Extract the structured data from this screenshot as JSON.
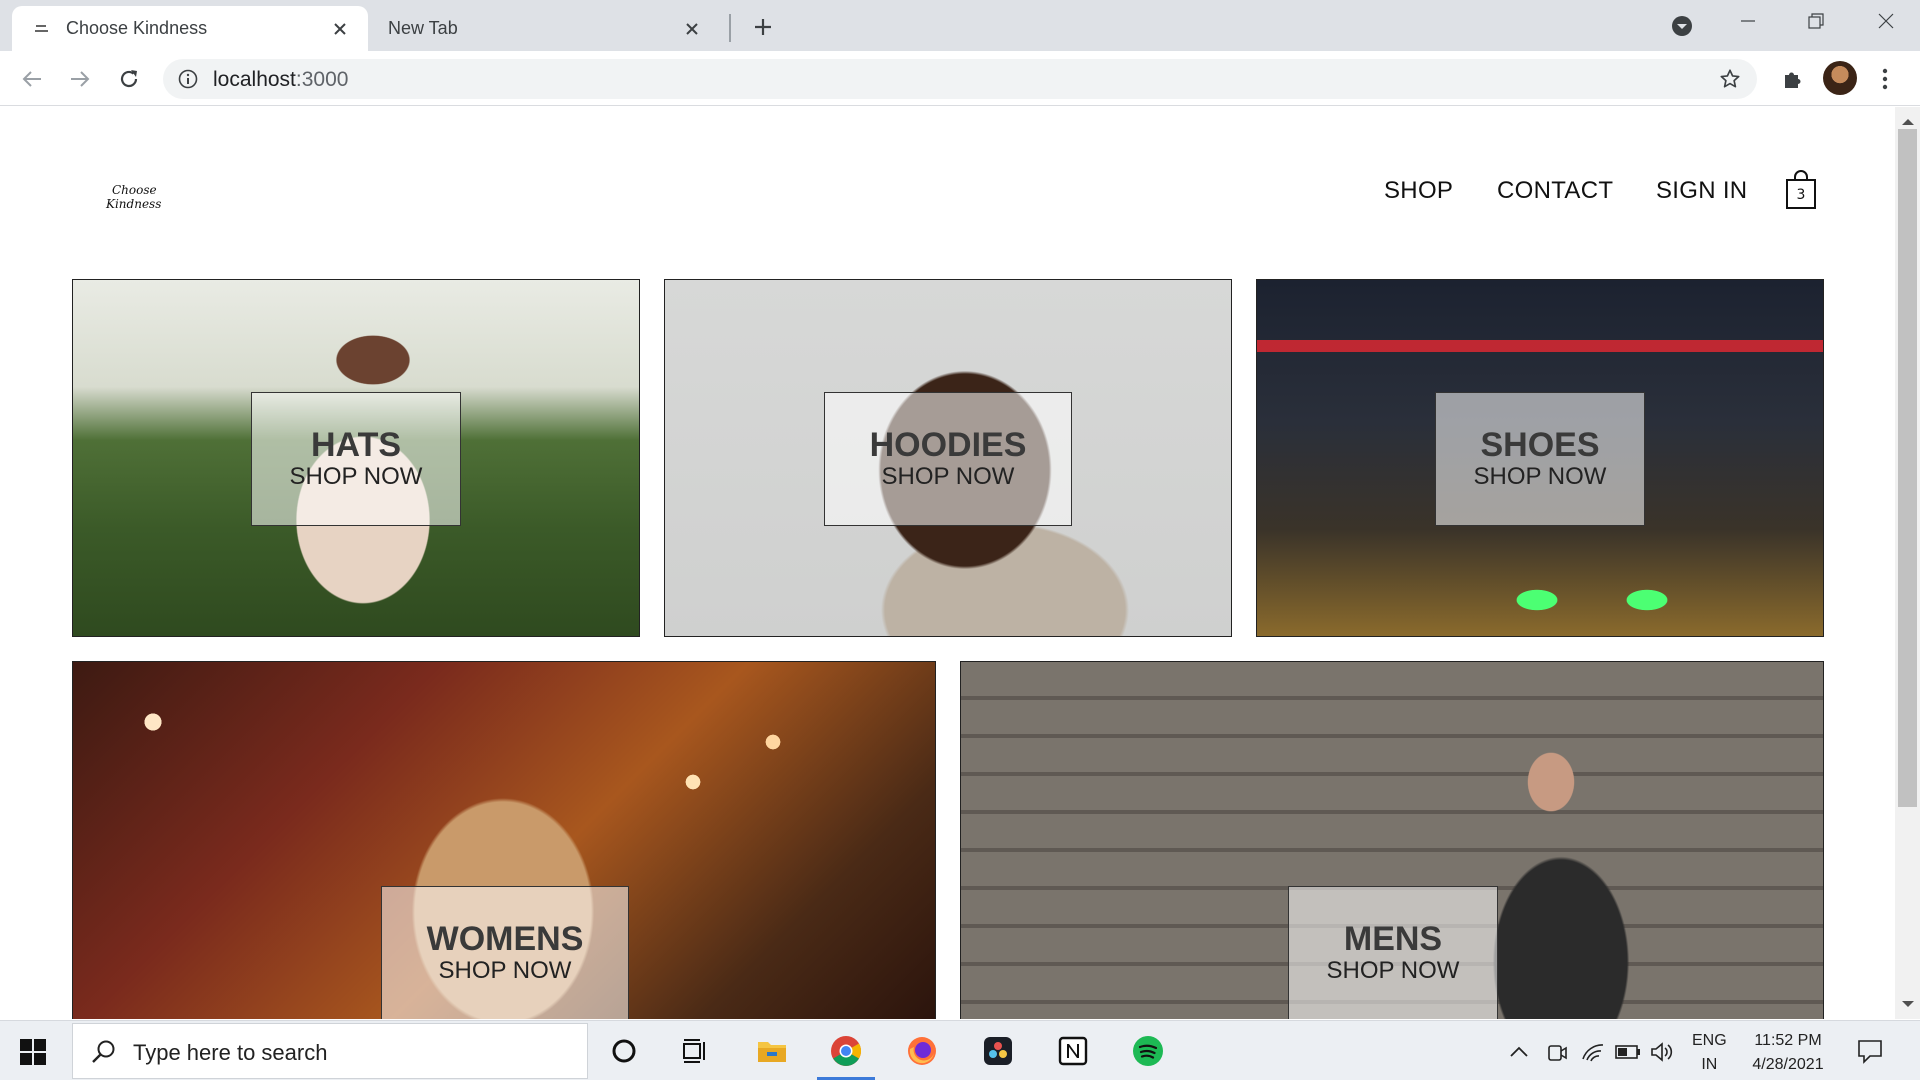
{
  "browser": {
    "tabs": [
      {
        "label": "Choose Kindness",
        "active": true
      },
      {
        "label": "New Tab",
        "active": false
      }
    ],
    "url_host": "localhost",
    "url_port": ":3000"
  },
  "site": {
    "logo_line1": "Choose",
    "logo_line2": "Kindness",
    "nav": {
      "shop": "SHOP",
      "contact": "CONTACT",
      "signin": "SIGN IN"
    },
    "cart_count": "3"
  },
  "categories": [
    {
      "title": "HATS",
      "cta": "SHOP NOW"
    },
    {
      "title": "HOODIES",
      "cta": "SHOP NOW"
    },
    {
      "title": "SHOES",
      "cta": "SHOP NOW"
    },
    {
      "title": "WOMENS",
      "cta": "SHOP NOW"
    },
    {
      "title": "MENS",
      "cta": "SHOP NOW"
    }
  ],
  "taskbar": {
    "search_placeholder": "Type here to search",
    "apps": [
      "cortana-icon",
      "task-view-icon",
      "file-explorer-icon",
      "chrome-icon",
      "firefox-icon",
      "davinci-resolve-icon",
      "notion-icon",
      "spotify-icon"
    ],
    "lang_line1": "ENG",
    "lang_line2": "IN",
    "time": "11:52 PM",
    "date": "4/28/2021"
  }
}
